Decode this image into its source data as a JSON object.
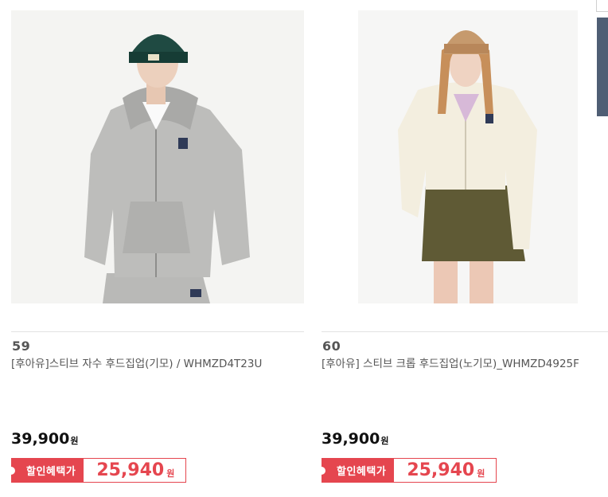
{
  "products": [
    {
      "rank": "59",
      "name": "[후아유]스티브 자수 후드집업(기모) / WHMZD4T23U",
      "price": "39,900",
      "currency": "원",
      "benefit_label": "할인혜택가",
      "benefit_price": "25,940",
      "benefit_currency": "원",
      "image": "model-gray-hoodie-green-beanie"
    },
    {
      "rank": "60",
      "name": "[후아유] 스티브 크롭 후드집업(노기모)_WHMZD4925F",
      "price": "39,900",
      "currency": "원",
      "benefit_label": "할인혜택가",
      "benefit_price": "25,940",
      "benefit_currency": "원",
      "image": "model-ivory-cropped-hoodie-khaki-skirt"
    }
  ],
  "colors": {
    "accent": "#e5464f",
    "side_panel": "#4f5e74"
  }
}
